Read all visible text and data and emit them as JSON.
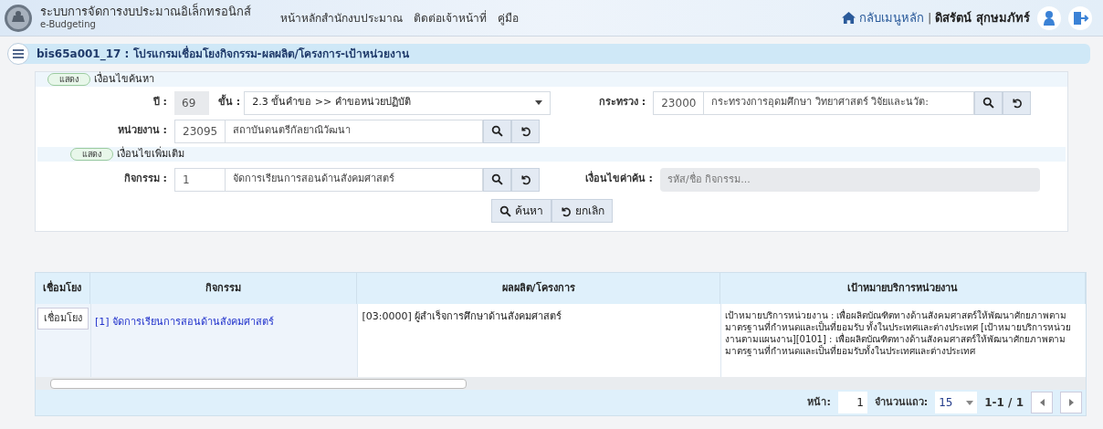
{
  "header": {
    "system_name": "ระบบการจัดการงบประมาณอิเล็กทรอนิกส์",
    "subtitle": "e-Budgeting",
    "nav": [
      "หน้าหลักสำนักงบประมาณ",
      "ติดต่อเจ้าหน้าที่",
      "คู่มือ"
    ],
    "home_link": "กลับเมนูหลัก",
    "separator": "|",
    "user_name": "ดิสรัตน์ สุกษมภัทร์"
  },
  "page_title": "bis65a001_17 : โปรแกรมเชื่อมโยงกิจกรรม-ผลผลิต/โครงการ-เป้าหน่วยงาน",
  "search_section": {
    "toggle": "แสดง",
    "title": "เงื่อนไขค้นหา"
  },
  "year": {
    "label": "ปี :",
    "value": "69"
  },
  "step": {
    "label": "ขั้น :",
    "value": "2.3 ขั้นคำขอ >> คำขอหน่วยปฏิบัติ"
  },
  "ministry": {
    "label": "กระทรวง :",
    "code": "23000",
    "name": "กระทรวงการอุดมศึกษา วิทยาศาสตร์ วิจัยและนวัต:"
  },
  "agency": {
    "label": "หน่วยงาน :",
    "code": "23095",
    "name": "สถาบันดนตรีกัลยาณิวัฒนา"
  },
  "extra_section": {
    "toggle": "แสดง",
    "title": "เงื่อนไขเพิ่มเติม"
  },
  "activity": {
    "label": "กิจกรรม :",
    "code": "1",
    "name": "จัดการเรียนการสอนด้านสังคมศาสตร์"
  },
  "keyword": {
    "label": "เงื่อนไขค่าค้น :",
    "placeholder": "รหัส/ชื่อ กิจกรรม..."
  },
  "buttons": {
    "search": "ค้นหา",
    "cancel": "ยกเลิก"
  },
  "table": {
    "columns": [
      "เชื่อมโยง",
      "กิจกรรม",
      "ผลผลิต/โครงการ",
      "เป้าหมายบริการหน่วยงาน"
    ],
    "rows": [
      {
        "link_button": "เชื่อมโยง",
        "activity": "[1] จัดการเรียนการสอนด้านสังคมศาสตร์",
        "output": "[03:0000] ผู้สำเร็จการศึกษาด้านสังคมศาสตร์",
        "goal": "เป้าหมายบริการหน่วยงาน : เพื่อผลิตบัณฑิตทางด้านสังคมศาสตร์ให้พัฒนาศักยภาพตามมาตรฐานที่กำหนดและเป็นที่ยอมรับ ทั้งในประเทศและต่างประเทศ [เป้าหมายบริการหน่วยงานตามแผนงาน][0101] : เพื่อผลิตบัณฑิตทางด้านสังคมศาสตร์ให้พัฒนาศักยภาพตามมาตรฐานที่กำหนดและเป็นที่ยอมรับทั้งในประเทศและต่างประเทศ"
      }
    ]
  },
  "pager": {
    "page_label": "หน้า:",
    "page": "1",
    "rows_label": "จำนวนแถว:",
    "rows_per_page": "15",
    "range": "1-1 / 1"
  }
}
